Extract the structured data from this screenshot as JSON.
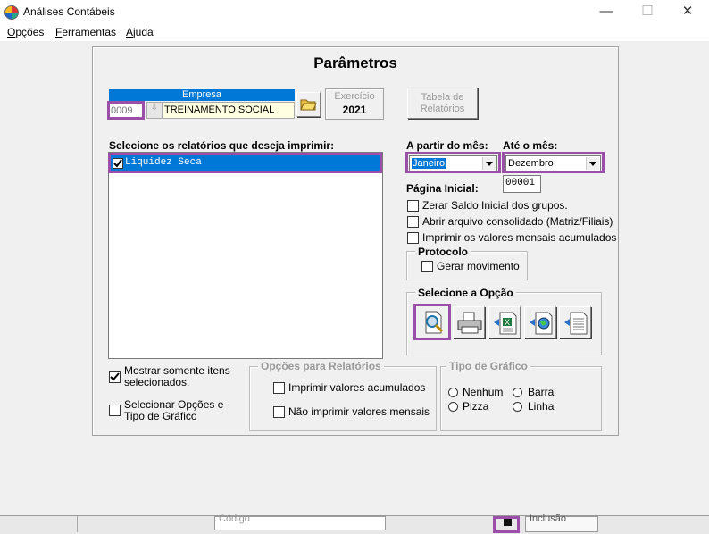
{
  "window": {
    "title": "Análises Contábeis",
    "minimize": "—",
    "maximize": "☐",
    "close": "✕"
  },
  "menu": {
    "items": [
      {
        "key": "O",
        "rest": "pções"
      },
      {
        "key": "F",
        "rest": "erramentas"
      },
      {
        "key": "A",
        "rest": "juda"
      }
    ]
  },
  "params": {
    "title": "Parâmetros",
    "empresa": {
      "header": "Empresa",
      "code": "0009",
      "name": "TREINAMENTO SOCIAL"
    },
    "exercicio": {
      "label": "Exercício",
      "value": "2021"
    },
    "tabela_btn": {
      "line1": "Tabela de",
      "line2": "Relatórios"
    },
    "reports_label": "Selecione os relatórios que deseja imprimir:",
    "reports": [
      {
        "label": "Liquidez Seca",
        "checked": true
      }
    ],
    "from_month_label": "A partir do mês:",
    "from_month": "Janeiro",
    "to_month_label": "Até o mês:",
    "to_month": "Dezembro",
    "page_label": "Página Inicial:",
    "page_value": "00001",
    "options": [
      "Zerar Saldo Inicial dos grupos.",
      "Abrir arquivo consolidado (Matriz/Filiais)",
      "Imprimir os valores mensais acumulados"
    ],
    "protocolo": {
      "title": "Protocolo",
      "option": "Gerar movimento"
    },
    "select_option": {
      "title": "Selecione a Opção"
    },
    "show_selected": {
      "line1": "Mostrar somente itens",
      "line2": "selecionados.",
      "checked": true
    },
    "select_chart": {
      "line1": "Selecionar Opções e",
      "line2": "Tipo de Gráfico",
      "checked": false
    },
    "report_options": {
      "title": "Opções para Relatórios",
      "items": [
        "Imprimir valores acumulados",
        "Não imprimir valores mensais"
      ]
    },
    "chart_type": {
      "title": "Tipo de Gráfico",
      "items": [
        "Nenhum",
        "Barra",
        "Pizza",
        "Linha"
      ]
    }
  },
  "taskbar": {
    "codigo": "Código",
    "right": "Inclusão"
  },
  "colors": {
    "highlight": "#9b4fa8",
    "selection": "#0078d7"
  }
}
